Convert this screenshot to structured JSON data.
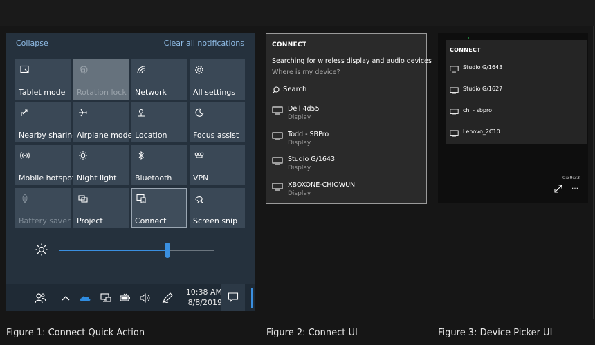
{
  "action_center": {
    "collapse_label": "Collapse",
    "clear_label": "Clear all notifications",
    "tiles": [
      {
        "label": "Tablet mode",
        "icon": "tablet-mode-icon",
        "state": "normal"
      },
      {
        "label": "Rotation lock",
        "icon": "rotation-lock-icon",
        "state": "disabled"
      },
      {
        "label": "Network",
        "icon": "network-icon",
        "state": "normal"
      },
      {
        "label": "All settings",
        "icon": "gear-icon",
        "state": "normal"
      },
      {
        "label": "Nearby sharing",
        "icon": "nearby-sharing-icon",
        "state": "normal"
      },
      {
        "label": "Airplane mode",
        "icon": "airplane-icon",
        "state": "normal"
      },
      {
        "label": "Location",
        "icon": "location-icon",
        "state": "normal"
      },
      {
        "label": "Focus assist",
        "icon": "moon-icon",
        "state": "normal"
      },
      {
        "label": "Mobile hotspot",
        "icon": "hotspot-icon",
        "state": "normal"
      },
      {
        "label": "Night light",
        "icon": "night-light-icon",
        "state": "normal"
      },
      {
        "label": "Bluetooth",
        "icon": "bluetooth-icon",
        "state": "normal"
      },
      {
        "label": "VPN",
        "icon": "vpn-icon",
        "state": "normal"
      },
      {
        "label": "Battery saver",
        "icon": "battery-saver-icon",
        "state": "disabled"
      },
      {
        "label": "Project",
        "icon": "project-icon",
        "state": "normal"
      },
      {
        "label": "Connect",
        "icon": "connect-icon",
        "state": "selected"
      },
      {
        "label": "Screen snip",
        "icon": "screen-snip-icon",
        "state": "normal"
      }
    ],
    "brightness": 0.7,
    "taskbar": {
      "time": "10:38 AM",
      "date": "8/8/2019"
    }
  },
  "connect_ui": {
    "title": "CONNECT",
    "status": "Searching for wireless display and audio devices",
    "help_link": "Where is my device?",
    "search_label": "Search",
    "devices": [
      {
        "name": "Dell 4d55",
        "type": "Display"
      },
      {
        "name": "Todd - SBPro",
        "type": "Display"
      },
      {
        "name": "Studio G/1643",
        "type": "Display"
      },
      {
        "name": "XBOXONE-CHIOWUN",
        "type": "Display"
      }
    ]
  },
  "device_picker": {
    "title": "CONNECT",
    "devices": [
      "Studio G/1643",
      "Studio G/1627",
      "chi - sbpro",
      "Lenovo_2C10"
    ],
    "time": "0:39:33",
    "more_label": "…"
  },
  "captions": {
    "fig1": "Figure 1: Connect Quick Action",
    "fig2": "Figure 2: Connect UI",
    "fig3": "Figure 3: Device Picker UI"
  },
  "colors": {
    "accent": "#3a8fe0",
    "link": "#8fbce6",
    "action_center_bg": "#25313d",
    "tile_bg": "#3a4856"
  }
}
